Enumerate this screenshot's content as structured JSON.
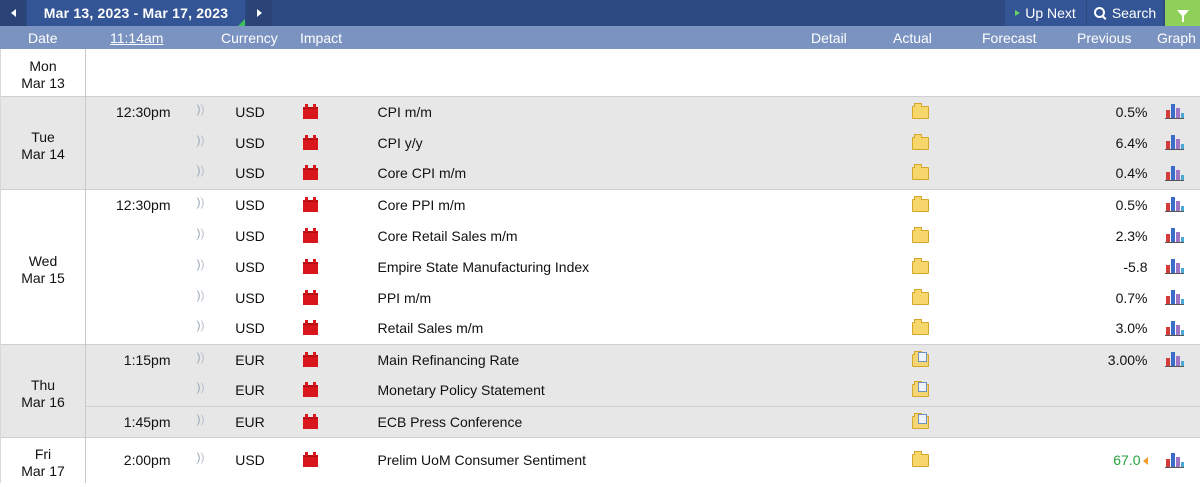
{
  "toolbar": {
    "date_range": "Mar 13, 2023 - Mar 17, 2023",
    "up_next_label": "Up Next",
    "search_label": "Search"
  },
  "columns": {
    "date": "Date",
    "time": "11:14am",
    "currency": "Currency",
    "impact": "Impact",
    "detail": "Detail",
    "actual": "Actual",
    "forecast": "Forecast",
    "previous": "Previous",
    "graph": "Graph"
  },
  "colors": {
    "header_bg": "#2d4a82",
    "colhead_bg": "#7a93c0",
    "impact_high": "#d8161b",
    "better_value": "#2aa03a"
  },
  "days": [
    {
      "dow": "Mon",
      "date": "Mar 13",
      "events": []
    },
    {
      "dow": "Tue",
      "date": "Mar 14",
      "events": [
        {
          "time": "12:30pm",
          "currency": "USD",
          "impact": "high",
          "event": "CPI m/m",
          "detail_icon": "folder-icon",
          "actual": "",
          "forecast": "",
          "previous": "0.5%",
          "graph": true
        },
        {
          "time": "",
          "currency": "USD",
          "impact": "high",
          "event": "CPI y/y",
          "detail_icon": "folder-icon",
          "actual": "",
          "forecast": "",
          "previous": "6.4%",
          "graph": true
        },
        {
          "time": "",
          "currency": "USD",
          "impact": "high",
          "event": "Core CPI m/m",
          "detail_icon": "folder-icon",
          "actual": "",
          "forecast": "",
          "previous": "0.4%",
          "graph": true
        }
      ]
    },
    {
      "dow": "Wed",
      "date": "Mar 15",
      "events": [
        {
          "time": "12:30pm",
          "currency": "USD",
          "impact": "high",
          "event": "Core PPI m/m",
          "detail_icon": "folder-icon",
          "actual": "",
          "forecast": "",
          "previous": "0.5%",
          "graph": true
        },
        {
          "time": "",
          "currency": "USD",
          "impact": "high",
          "event": "Core Retail Sales m/m",
          "detail_icon": "folder-icon",
          "actual": "",
          "forecast": "",
          "previous": "2.3%",
          "graph": true
        },
        {
          "time": "",
          "currency": "USD",
          "impact": "high",
          "event": "Empire State Manufacturing Index",
          "detail_icon": "folder-icon",
          "actual": "",
          "forecast": "",
          "previous": "-5.8",
          "graph": true
        },
        {
          "time": "",
          "currency": "USD",
          "impact": "high",
          "event": "PPI m/m",
          "detail_icon": "folder-icon",
          "actual": "",
          "forecast": "",
          "previous": "0.7%",
          "graph": true
        },
        {
          "time": "",
          "currency": "USD",
          "impact": "high",
          "event": "Retail Sales m/m",
          "detail_icon": "folder-icon",
          "actual": "",
          "forecast": "",
          "previous": "3.0%",
          "graph": true
        }
      ]
    },
    {
      "dow": "Thu",
      "date": "Mar 16",
      "events": [
        {
          "time": "1:15pm",
          "currency": "EUR",
          "impact": "high",
          "event": "Main Refinancing Rate",
          "detail_icon": "folder-doc-icon",
          "actual": "",
          "forecast": "",
          "previous": "3.00%",
          "graph": true
        },
        {
          "time": "",
          "currency": "EUR",
          "impact": "high",
          "event": "Monetary Policy Statement",
          "detail_icon": "folder-doc-icon",
          "actual": "",
          "forecast": "",
          "previous": "",
          "graph": false
        },
        {
          "time": "1:45pm",
          "currency": "EUR",
          "impact": "high",
          "event": "ECB Press Conference",
          "detail_icon": "folder-doc-icon",
          "actual": "",
          "forecast": "",
          "previous": "",
          "graph": false
        }
      ]
    },
    {
      "dow": "Fri",
      "date": "Mar 17",
      "events": [
        {
          "time": "2:00pm",
          "currency": "USD",
          "impact": "high",
          "event": "Prelim UoM Consumer Sentiment",
          "detail_icon": "folder-icon",
          "actual": "",
          "forecast": "",
          "previous": "67.0",
          "previous_better": true,
          "graph": true
        }
      ]
    }
  ]
}
